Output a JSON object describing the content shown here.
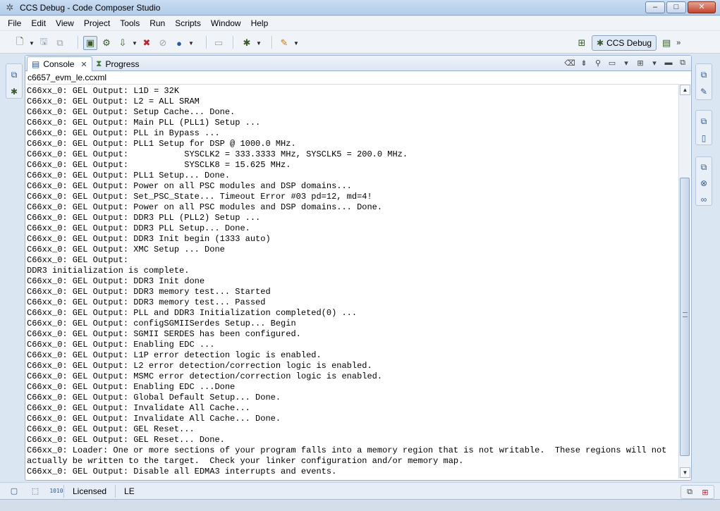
{
  "window": {
    "title": "CCS Debug - Code Composer Studio",
    "icon": "ccs-app-icon",
    "minimize": "–",
    "maximize": "□",
    "close": "✕"
  },
  "menu": [
    "File",
    "Edit",
    "View",
    "Project",
    "Tools",
    "Run",
    "Scripts",
    "Window",
    "Help"
  ],
  "perspective": {
    "active": "CCS Debug",
    "more": "»"
  },
  "view": {
    "tabs": [
      {
        "label": "Console",
        "icon": "console-icon",
        "active": true
      },
      {
        "label": "Progress",
        "icon": "progress-icon",
        "active": false
      }
    ],
    "console_name": "c6657_evm_le.ccxml"
  },
  "console_lines": [
    "C66xx_0: GEL Output: L1D = 32K",
    "C66xx_0: GEL Output: L2 = ALL SRAM",
    "C66xx_0: GEL Output: Setup Cache... Done.",
    "C66xx_0: GEL Output: Main PLL (PLL1) Setup ...",
    "C66xx_0: GEL Output: PLL in Bypass ...",
    "C66xx_0: GEL Output: PLL1 Setup for DSP @ 1000.0 MHz.",
    "C66xx_0: GEL Output:           SYSCLK2 = 333.3333 MHz, SYSCLK5 = 200.0 MHz.",
    "C66xx_0: GEL Output:           SYSCLK8 = 15.625 MHz.",
    "C66xx_0: GEL Output: PLL1 Setup... Done.",
    "C66xx_0: GEL Output: Power on all PSC modules and DSP domains...",
    "C66xx_0: GEL Output: Set_PSC_State... Timeout Error #03 pd=12, md=4!",
    "C66xx_0: GEL Output: Power on all PSC modules and DSP domains... Done.",
    "C66xx_0: GEL Output: DDR3 PLL (PLL2) Setup ...",
    "C66xx_0: GEL Output: DDR3 PLL Setup... Done.",
    "C66xx_0: GEL Output: DDR3 Init begin (1333 auto)",
    "C66xx_0: GEL Output: XMC Setup ... Done",
    "C66xx_0: GEL Output:",
    "DDR3 initialization is complete.",
    "C66xx_0: GEL Output: DDR3 Init done",
    "C66xx_0: GEL Output: DDR3 memory test... Started",
    "C66xx_0: GEL Output: DDR3 memory test... Passed",
    "C66xx_0: GEL Output: PLL and DDR3 Initialization completed(0) ...",
    "C66xx_0: GEL Output: configSGMIISerdes Setup... Begin",
    "C66xx_0: GEL Output: SGMII SERDES has been configured.",
    "C66xx_0: GEL Output: Enabling EDC ...",
    "C66xx_0: GEL Output: L1P error detection logic is enabled.",
    "C66xx_0: GEL Output: L2 error detection/correction logic is enabled.",
    "C66xx_0: GEL Output: MSMC error detection/correction logic is enabled.",
    "C66xx_0: GEL Output: Enabling EDC ...Done",
    "C66xx_0: GEL Output: Global Default Setup... Done.",
    "C66xx_0: GEL Output: Invalidate All Cache...",
    "C66xx_0: GEL Output: Invalidate All Cache... Done.",
    "C66xx_0: GEL Output: GEL Reset...",
    "C66xx_0: GEL Output: GEL Reset... Done.",
    "C66xx_0: Loader: One or more sections of your program falls into a memory region that is not writable.  These regions will not",
    "actually be written to the target.  Check your linker configuration and/or memory map.",
    "C66xx_0: GEL Output: Disable all EDMA3 interrupts and events."
  ],
  "status": {
    "license": "Licensed",
    "edition": "LE"
  }
}
